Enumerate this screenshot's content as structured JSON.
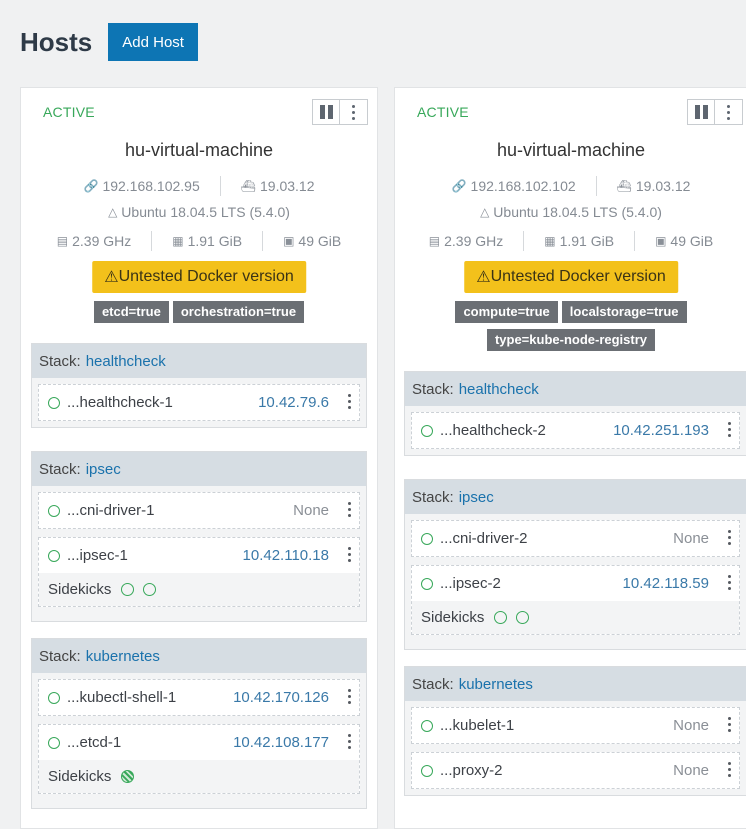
{
  "page": {
    "title": "Hosts",
    "add_button": "Add Host"
  },
  "hosts": [
    {
      "state": "ACTIVE",
      "name": "hu-virtual-machine",
      "ip": "192.168.102.95",
      "docker_version": "19.03.12",
      "os": "Ubuntu 18.04.5 LTS (5.4.0)",
      "cpu": "2.39 GHz",
      "memory": "1.91 GiB",
      "storage": "49 GiB",
      "warning": "Untested Docker version",
      "labels": [
        "etcd=true",
        "orchestration=true"
      ],
      "stacks": [
        {
          "prefix": "Stack:",
          "name": "healthcheck",
          "containers": [
            {
              "name": "...healthcheck-1",
              "ip": "10.42.79.6"
            }
          ]
        },
        {
          "prefix": "Stack:",
          "name": "ipsec",
          "containers": [
            {
              "name": "...cni-driver-1",
              "ip": "None"
            },
            {
              "name": "...ipsec-1",
              "ip": "10.42.110.18"
            }
          ],
          "sidekicks": "Sidekicks"
        },
        {
          "prefix": "Stack:",
          "name": "kubernetes",
          "containers": [
            {
              "name": "...kubectl-shell-1",
              "ip": "10.42.170.126"
            },
            {
              "name": "...etcd-1",
              "ip": "10.42.108.177"
            }
          ],
          "sidekicks": "Sidekicks"
        }
      ]
    },
    {
      "state": "ACTIVE",
      "name": "hu-virtual-machine",
      "ip": "192.168.102.102",
      "docker_version": "19.03.12",
      "os": "Ubuntu 18.04.5 LTS (5.4.0)",
      "cpu": "2.39 GHz",
      "memory": "1.91 GiB",
      "storage": "49 GiB",
      "warning": "Untested Docker version",
      "labels": [
        "compute=true",
        "localstorage=true",
        "type=kube-node-registry"
      ],
      "stacks": [
        {
          "prefix": "Stack:",
          "name": "healthcheck",
          "containers": [
            {
              "name": "...healthcheck-2",
              "ip": "10.42.251.193"
            }
          ]
        },
        {
          "prefix": "Stack:",
          "name": "ipsec",
          "containers": [
            {
              "name": "...cni-driver-2",
              "ip": "None"
            },
            {
              "name": "...ipsec-2",
              "ip": "10.42.118.59"
            }
          ],
          "sidekicks": "Sidekicks"
        },
        {
          "prefix": "Stack:",
          "name": "kubernetes",
          "containers": [
            {
              "name": "...kubelet-1",
              "ip": "None"
            },
            {
              "name": "...proxy-2",
              "ip": "None"
            }
          ]
        }
      ]
    }
  ],
  "colors": {
    "active": "#38a85a",
    "primary": "#0d75b4",
    "warning": "#f3c11b",
    "link": "#1a72ac"
  },
  "icons": [
    "pause-icon",
    "more-vert-icon",
    "link-icon",
    "docker-icon",
    "linux-icon",
    "cpu-icon",
    "memory-icon",
    "storage-icon",
    "warning-icon"
  ]
}
